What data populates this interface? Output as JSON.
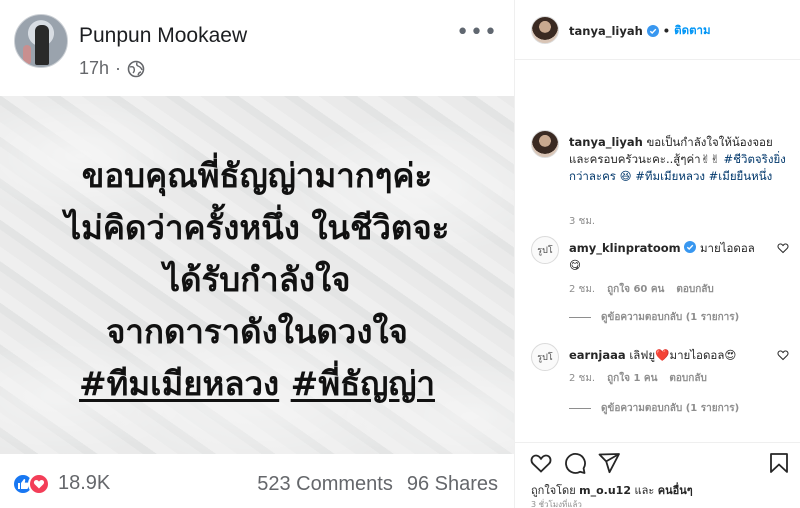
{
  "facebook": {
    "author": "Punpun Mookaew",
    "time": "17h",
    "bullet": "·",
    "more": "•••",
    "quote_lines": [
      "ขอบคุณพี่ธัญญ่ามากๆค่ะ",
      "ไม่คิดว่าครั้งหนึ่ง ในชีวิตจะ",
      "ได้รับกำลังใจ",
      "จากดาราดังในดวงใจ"
    ],
    "quote_tags": [
      "#ทีมเมียหลวง",
      "#พี่ธัญญ่า"
    ],
    "reactions_count": "18.9K",
    "comments": "523 Comments",
    "shares": "96 Shares",
    "colors": {
      "like": "#1877f2",
      "love": "#f33e58"
    }
  },
  "instagram": {
    "header_user": "tanya_liyah",
    "header_separator": "•",
    "follow_label": "ติดตาม",
    "caption": {
      "user": "tanya_liyah",
      "text": "ขอเป็นกำลังใจให้น้องจอยและครอบครัวนะคะ..สู้ๆค่า✌✌",
      "hashtags": "#ชีวิตจริงยิ่งกว่าละคร 😆 #ทีมเมียหลวง #เมียยืนหนึ่ง",
      "time": "3 ชม."
    },
    "comments": [
      {
        "avatar_text": "รูปโ",
        "user": "amy_klinpratoom",
        "text": "มายไอดอล 😋",
        "time": "2 ชม.",
        "likes": "ถูกใจ 60 คน",
        "reply": "ตอบกลับ",
        "view_replies": "ดูข้อความตอบกลับ (1 รายการ)"
      },
      {
        "avatar_text": "รูปโ",
        "user": "earnjaaa",
        "text": "เลิฟยู❤️มายไอดอล😍",
        "time": "2 ชม.",
        "likes": "ถูกใจ 1 คน",
        "reply": "ตอบกลับ",
        "view_replies": "ดูข้อความตอบกลับ (1 รายการ)"
      }
    ],
    "liked_by_prefix": "ถูกใจโดย",
    "liked_by_user": "m_o.u12",
    "liked_by_and": "และ",
    "liked_by_others": "คนอื่นๆ",
    "post_time": "3 ชั่วโมงที่แล้ว",
    "colors": {
      "accent": "#0095f6",
      "hashtag": "#00376b",
      "muted": "#8e8e8e"
    }
  }
}
